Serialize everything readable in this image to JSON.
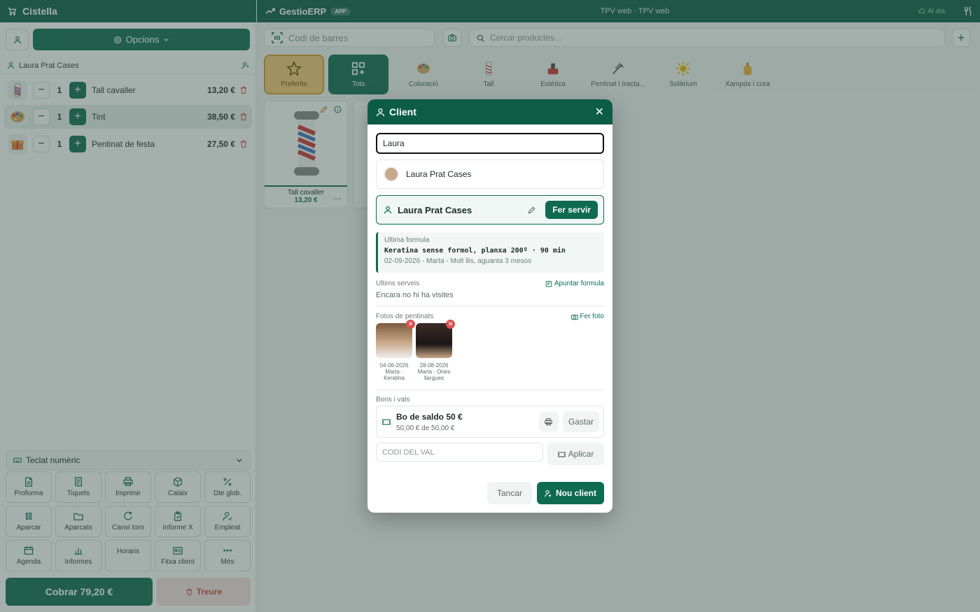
{
  "left": {
    "title": "Cistella",
    "options_label": "Opcions",
    "customer": "Laura Prat Cases",
    "lines": [
      {
        "name": "Tall cavaller",
        "qty": "1",
        "price": "13,20 €"
      },
      {
        "name": "Tint",
        "qty": "1",
        "price": "38,50 €"
      },
      {
        "name": "Pentinat de festa",
        "qty": "1",
        "price": "27,50 €"
      }
    ],
    "keypad_label": "Teclat numèric",
    "buttons": [
      {
        "label": "Proforma",
        "icon": "file-icon"
      },
      {
        "label": "Tiquets",
        "icon": "receipt-icon"
      },
      {
        "label": "Imprimir",
        "icon": "printer-icon"
      },
      {
        "label": "Calaix",
        "icon": "box-icon"
      },
      {
        "label": "Dte glob.",
        "icon": "percent-icon"
      },
      {
        "label": "Aparcar",
        "icon": "pause-icon"
      },
      {
        "label": "Aparcats",
        "icon": "folder-icon"
      },
      {
        "label": "Canvi torn",
        "icon": "refresh-icon"
      },
      {
        "label": "Informe X",
        "icon": "clipboard-icon"
      },
      {
        "label": "Empleat",
        "icon": "user-check-icon"
      },
      {
        "label": "Agenda",
        "icon": "calendar-icon"
      },
      {
        "label": "Informes",
        "icon": "bar-chart-icon"
      },
      {
        "label": "Horaris",
        "icon": ""
      },
      {
        "label": "Fitxa client",
        "icon": "id-card-icon"
      },
      {
        "label": "Més",
        "icon": "more-icon"
      }
    ],
    "charge_label": "Cobrar",
    "charge_amount": "79,20 €",
    "remove_label": "Treure"
  },
  "right": {
    "brand": "GestioERP",
    "badge": "APP",
    "window_title": "TPV web · TPV web",
    "status": "Al dia",
    "barcode_placeholder": "Codi de barres",
    "search_placeholder": "Cercar productes…",
    "categories": [
      {
        "label": "Preferits"
      },
      {
        "label": "Tots"
      },
      {
        "label": "Coloració"
      },
      {
        "label": "Tall"
      },
      {
        "label": "Estètica"
      },
      {
        "label": "Pentinat i tracta..."
      },
      {
        "label": "Solàrium"
      },
      {
        "label": "Xampús i cura"
      }
    ],
    "product": {
      "name": "Tall cavaller",
      "price": "13,20 €"
    }
  },
  "modal": {
    "title": "Client",
    "search_value": "Laura",
    "result_name": "Laura Prat Cases",
    "selected_name": "Laura Prat Cases",
    "use_label": "Fer servir",
    "formula_label": "Ultima formula",
    "formula_text": "Keratina sense formol, planxa 200º · 90 min",
    "formula_meta": "02-09-2026 - Marta - Molt llis, aguanta 3 mesos",
    "services_label": "Ultims serveis",
    "note_link": "Apuntar formula",
    "no_visits": "Encara no hi ha visites",
    "photos_label": "Fotos de pentinats",
    "photo_link": "Fer foto",
    "photos": [
      {
        "date": "04-06-2026",
        "caption1": "Marta ·",
        "caption2": "Keratina"
      },
      {
        "date": "28-08-2026",
        "caption1": "Marta · Ones",
        "caption2": "llargues"
      }
    ],
    "vouchers_label": "Bons i vals",
    "voucher_title": "Bo de saldo 50 €",
    "voucher_balance": "50,00 € de 50,00 €",
    "spend_label": "Gastar",
    "code_placeholder": "CODI DEL VAL",
    "apply_label": "Aplicar",
    "close_label": "Tancar",
    "new_client_label": "Nou client"
  },
  "colors": {
    "primary": "#0f6b50",
    "header": "#0d5c45",
    "danger": "#d9534f",
    "accent": "#e0a52e"
  }
}
